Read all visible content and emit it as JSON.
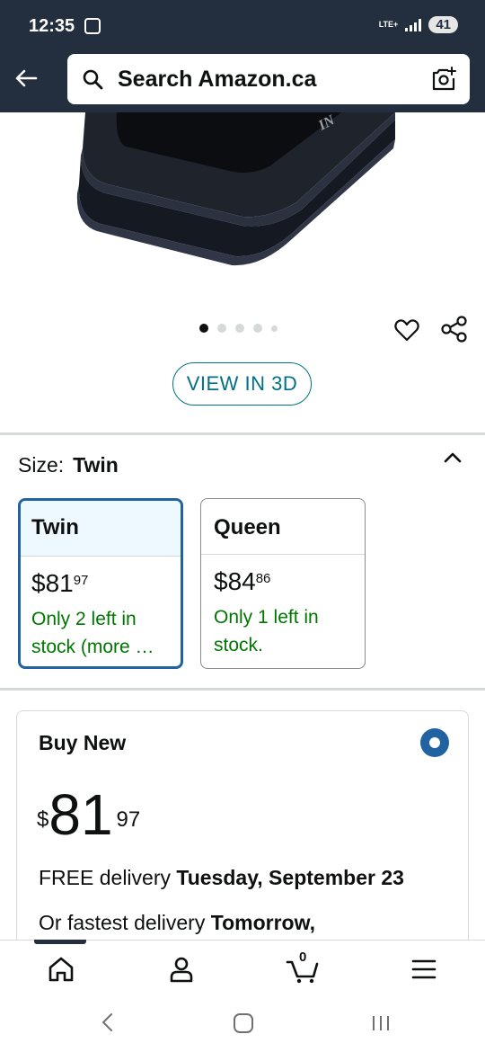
{
  "status_bar": {
    "time": "12:35",
    "network": "LTE+",
    "battery": "41"
  },
  "header": {
    "search_placeholder": "Search Amazon.ca"
  },
  "gallery": {
    "image_count": 5,
    "active_index": 0,
    "view3d_label": "VIEW IN 3D"
  },
  "size": {
    "label": "Size:",
    "selected": "Twin",
    "options": [
      {
        "name": "Twin",
        "price_whole": "$81",
        "price_cents": "97",
        "stock": "Only 2 left in stock (more …",
        "selected": true
      },
      {
        "name": "Queen",
        "price_whole": "$84",
        "price_cents": "86",
        "stock": "Only 1 left in stock.",
        "selected": false
      }
    ]
  },
  "buy_box": {
    "title": "Buy New",
    "currency": "$",
    "price_whole": "81",
    "price_cents": "97",
    "delivery_prefix": "FREE delivery ",
    "delivery_date": "Tuesday, September 23",
    "fastest_prefix": "Or fastest delivery ",
    "fastest_date": "Tomorrow,"
  },
  "bottom_nav": {
    "cart_count": "0",
    "items": [
      "home-icon",
      "account-icon",
      "cart-icon",
      "menu-icon"
    ]
  },
  "colors": {
    "header_bg": "#232f3e",
    "link": "#007185",
    "in_stock": "#007600",
    "selected_border": "#2162a1"
  }
}
